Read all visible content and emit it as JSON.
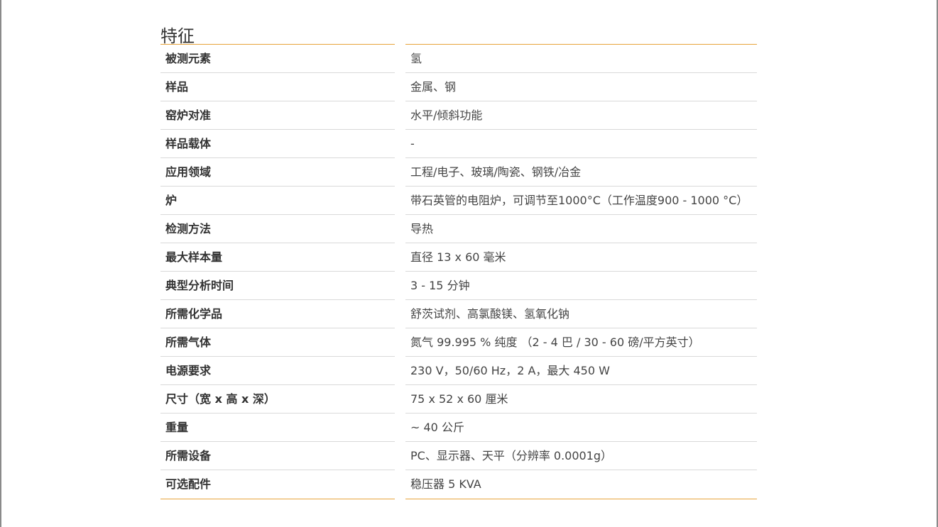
{
  "section": {
    "title": "特征"
  },
  "specs": [
    {
      "label": "被测元素",
      "value": "氢"
    },
    {
      "label": "样品",
      "value": "金属、钢"
    },
    {
      "label": "窑炉对准",
      "value": "水平/倾斜功能"
    },
    {
      "label": "样品载体",
      "value": "-"
    },
    {
      "label": "应用领域",
      "value": "工程/电子、玻璃/陶瓷、钢铁/冶金"
    },
    {
      "label": "炉",
      "value": "带石英管的电阻炉，可调节至1000°C（工作温度900 - 1000 °C）"
    },
    {
      "label": "检测方法",
      "value": "导热"
    },
    {
      "label": "最大样本量",
      "value": "直径 13 x 60 毫米"
    },
    {
      "label": "典型分析时间",
      "value": "3 - 15 分钟"
    },
    {
      "label": "所需化学品",
      "value": "舒茨试剂、高氯酸镁、氢氧化钠"
    },
    {
      "label": "所需气体",
      "value": "氮气 99.995 % 纯度 （2 - 4 巴 / 30 - 60 磅/平方英寸）"
    },
    {
      "label": "电源要求",
      "value": "230 V，50/60 Hz，2 A，最大 450 W"
    },
    {
      "label": "尺寸（宽 x 高 x 深）",
      "value": "75 x 52 x 60 厘米"
    },
    {
      "label": "重量",
      "value": "~ 40 公斤"
    },
    {
      "label": "所需设备",
      "value": "PC、显示器、天平（分辨率 0.0001g）"
    },
    {
      "label": "可选配件",
      "value": "稳压器 5 KVA"
    }
  ],
  "colors": {
    "accent_rule": "#e8a33a",
    "row_separator": "#d9d9d9",
    "text": "#333333"
  }
}
